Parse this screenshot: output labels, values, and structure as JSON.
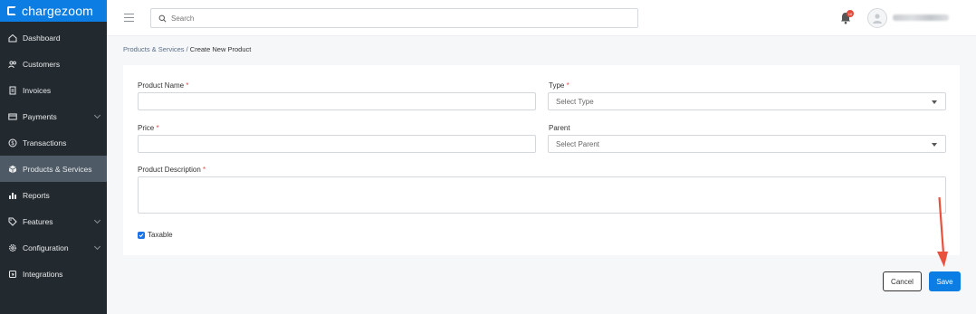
{
  "app": {
    "brand": "chargezoom"
  },
  "sidebar": {
    "items": [
      {
        "label": "Dashboard",
        "icon": "home-icon",
        "active": false,
        "has_chevron": false
      },
      {
        "label": "Customers",
        "icon": "users-icon",
        "active": false,
        "has_chevron": false
      },
      {
        "label": "Invoices",
        "icon": "invoice-icon",
        "active": false,
        "has_chevron": false
      },
      {
        "label": "Payments",
        "icon": "card-icon",
        "active": false,
        "has_chevron": true
      },
      {
        "label": "Transactions",
        "icon": "dollar-icon",
        "active": false,
        "has_chevron": false
      },
      {
        "label": "Products & Services",
        "icon": "box-icon",
        "active": true,
        "has_chevron": false
      },
      {
        "label": "Reports",
        "icon": "chart-icon",
        "active": false,
        "has_chevron": false
      },
      {
        "label": "Features",
        "icon": "tag-icon",
        "active": false,
        "has_chevron": true
      },
      {
        "label": "Configuration",
        "icon": "gear-icon",
        "active": false,
        "has_chevron": true
      },
      {
        "label": "Integrations",
        "icon": "plug-icon",
        "active": false,
        "has_chevron": false
      }
    ]
  },
  "header": {
    "search_placeholder": "Search",
    "notification_count": "10"
  },
  "breadcrumb": {
    "parent": "Products & Services",
    "separator": " / ",
    "current": "Create New Product"
  },
  "form": {
    "product_name_label": "Product Name",
    "type_label": "Type",
    "type_placeholder": "Select Type",
    "price_label": "Price",
    "parent_label": "Parent",
    "parent_placeholder": "Select Parent",
    "description_label": "Product Description",
    "required_mark": "*",
    "taxable_label": "Taxable",
    "taxable_checked": true
  },
  "actions": {
    "cancel_label": "Cancel",
    "save_label": "Save"
  },
  "colors": {
    "brand": "#0b7de3",
    "sidebar_bg": "#22292f",
    "sidebar_active": "#4e5a65",
    "annotation_arrow": "#e8523c"
  }
}
